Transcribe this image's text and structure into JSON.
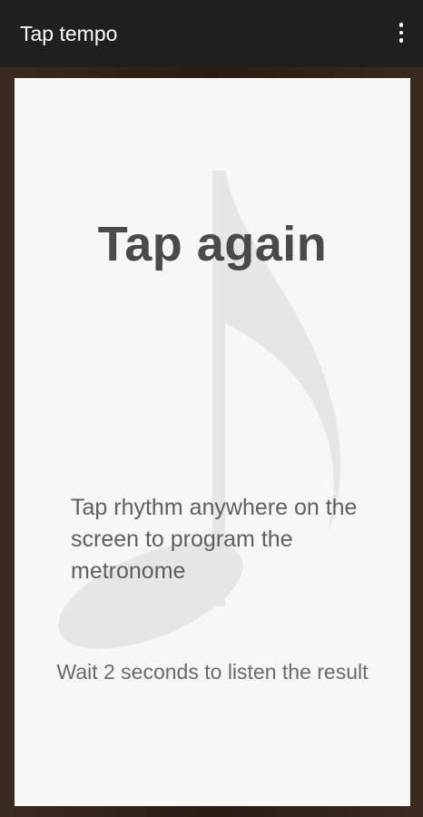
{
  "app_bar": {
    "title": "Tap tempo",
    "menu_icon": "more-vert-icon"
  },
  "main": {
    "headline": "Tap again",
    "instruction": "Tap rhythm anywhere on the screen to program the metronome",
    "wait_message": "Wait 2 seconds to listen the result",
    "background_icon": "music-note-icon"
  },
  "colors": {
    "app_bar": "#1f1f1f",
    "frame": "#2e2119",
    "panel": "#f7f7f7",
    "note_watermark": "#e6e6e6"
  }
}
